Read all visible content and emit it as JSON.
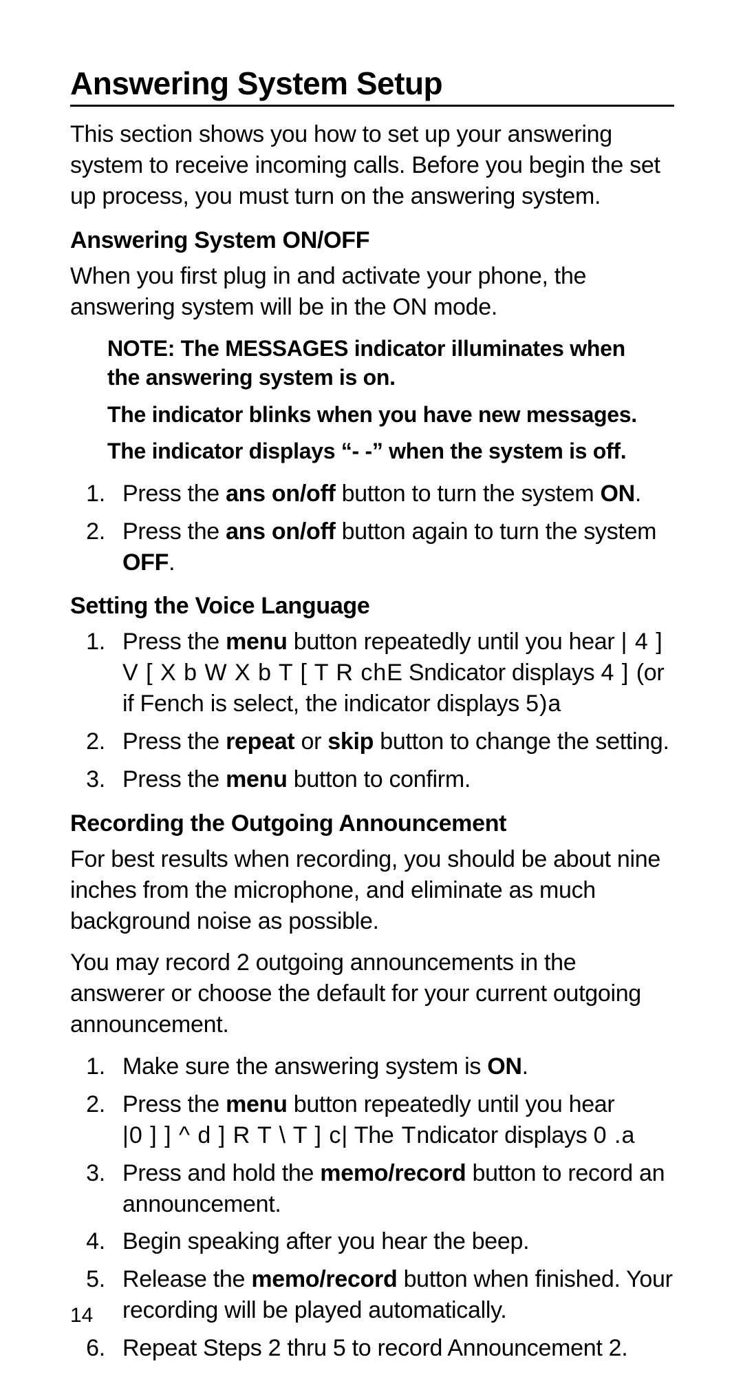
{
  "title": "Answering System Setup",
  "intro": "This section shows you how to set up your answering system to receive incoming calls. Before you begin the set up process, you must turn on the answering system.",
  "sec_onoff": {
    "heading": "Answering System ON/OFF",
    "body": "When you first plug in and activate your phone, the answering system will be in the ON mode.",
    "note1": "NOTE: The MESSAGES indicator illuminates when the answering system is on.",
    "note2": "The indicator blinks when you have new messages.",
    "note3": "The indicator displays “- -” when the system is off.",
    "step1_a": "Press the ",
    "step1_b": "ans on/off",
    "step1_c": " button to turn the system ",
    "step1_d": "ON",
    "step1_e": ".",
    "step2_a": "Press the ",
    "step2_b": "ans on/off",
    "step2_c": " button again to turn the system ",
    "step2_d": "OFF",
    "step2_e": "."
  },
  "sec_lang": {
    "heading": "Setting the Voice Language",
    "step1_a": "Press the ",
    "step1_b": "menu",
    "step1_c": " button repeatedly until you hear ",
    "step1_g1": " | 4 ] V [ X b W   X  b T [ T R ch",
    "step1_d": "E Sndicator displays ",
    "step1_g2": " 4 ] ",
    "step1_e": "(or if Fench is select, the indicator displays ",
    "step1_g3": " 5)a",
    "step2_a": "Press the ",
    "step2_b": "repeat",
    "step2_c": " or ",
    "step2_d": "skip",
    "step2_e": " button to change the setting.",
    "step3_a": "Press the ",
    "step3_b": "menu",
    "step3_c": " button to confirm."
  },
  "sec_rec": {
    "heading": "Recording the Outgoing Announcement",
    "body1": "For best results when recording, you should be about nine inches from the microphone, and eliminate as much background noise as possible.",
    "body2": "You may record 2 outgoing announcements in the answerer or choose the default for your current outgoing announcement.",
    "step1_a": "Make sure the answering system is ",
    "step1_b": "ON",
    "step1_c": ".",
    "step2_a": "Press the ",
    "step2_b": "menu",
    "step2_c": " button repeatedly until you hear ",
    "step2_g1": "|0 ] ] ^ d ] R T \\ T ] c|",
    "step2_d": " Th",
    "step2_g2": "e T",
    "step2_e": "ndicator displays ",
    "step2_g3": " 0 .a",
    "step3_a": "Press and hold the ",
    "step3_b": "memo/record",
    "step3_c": " button to record an announcement.",
    "step4": "Begin speaking after you hear the beep.",
    "step5_a": "Release the ",
    "step5_b": "memo/record",
    "step5_c": " button when finished. Your recording will be played automatically.",
    "step6": "Repeat Steps 2 thru 5 to record Announcement 2."
  },
  "page_number": "14"
}
